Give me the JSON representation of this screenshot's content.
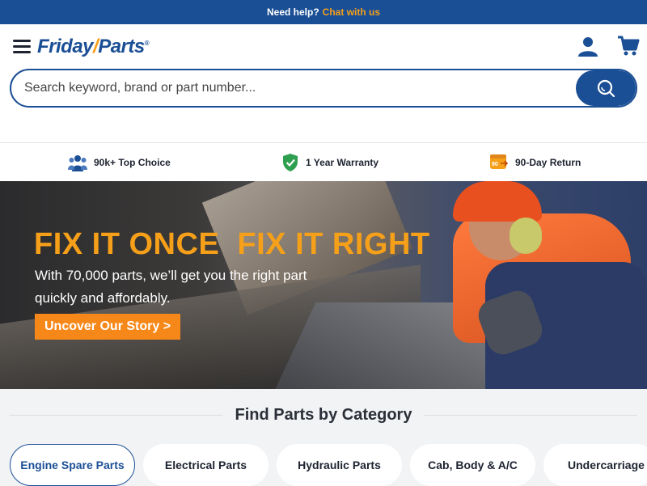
{
  "topbar": {
    "help_text": "Need help?",
    "chat_link": "Chat with us"
  },
  "header": {
    "logo_text_1": "Friday",
    "logo_mark": "/",
    "logo_text_2": "Parts",
    "logo_reg": "®",
    "menu_icon": "hamburger-icon",
    "account_icon": "user-icon",
    "cart_icon": "cart-icon"
  },
  "search": {
    "placeholder": "Search keyword, brand or part number...",
    "value": "",
    "button_icon": "search-icon"
  },
  "features": [
    {
      "icon": "people-icon",
      "label": "90k+ Top Choice"
    },
    {
      "icon": "shield-check-icon",
      "label": "1 Year Warranty"
    },
    {
      "icon": "return-90-icon",
      "label": "90-Day Return"
    }
  ],
  "hero": {
    "headline": "FIX IT ONCE  FIX IT RIGHT",
    "subtext": "With 70,000 parts, we’ll get you the right part quickly and affordably.",
    "cta_label": "Uncover Our Story >"
  },
  "categories": {
    "title": "Find Parts by Category",
    "items": [
      {
        "label": "Engine Spare Parts",
        "selected": true
      },
      {
        "label": "Electrical Parts",
        "selected": false
      },
      {
        "label": "Hydraulic Parts",
        "selected": false
      },
      {
        "label": "Cab, Body & A/C",
        "selected": false
      },
      {
        "label": "Undercarriage",
        "selected": false
      }
    ]
  },
  "colors": {
    "brand_blue": "#1b4f95",
    "accent_orange": "#f6a01a",
    "cta_orange": "#f6881a"
  }
}
